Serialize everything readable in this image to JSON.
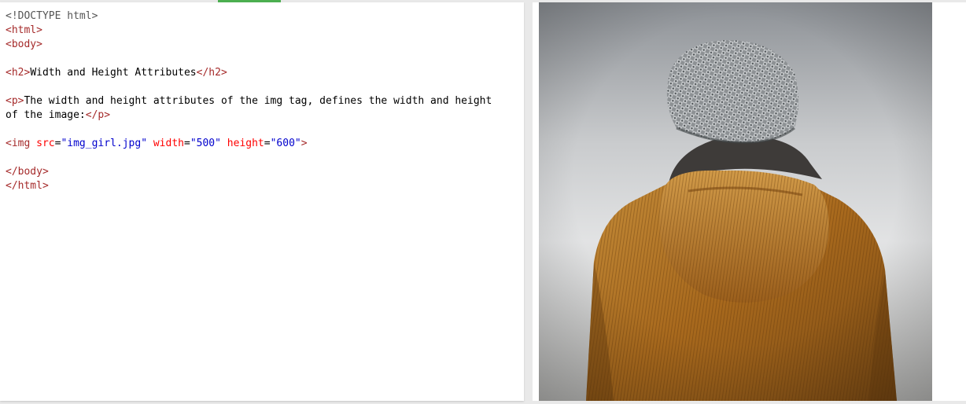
{
  "code": {
    "doctype": "<!DOCTYPE html>",
    "html_open_lt": "<",
    "html_open_name": "html",
    "html_open_gt": ">",
    "body_open_name": "body",
    "h2_name": "h2",
    "h2_text": "Width and Height Attributes",
    "h2_close_name": "/h2",
    "p_name": "p",
    "p_text_line1": "The width and height attributes of the img tag, defines the width and height",
    "p_text_line2": "of the image:",
    "p_close_name": "/p",
    "img_name": "img",
    "attr_src": "src",
    "val_src": "\"img_girl.jpg\"",
    "attr_width": "width",
    "val_width": "\"500\"",
    "attr_height": "height",
    "val_height": "\"600\"",
    "body_close_name": "/body",
    "html_close_name": "/html"
  },
  "result": {
    "image_subject": "person-in-knit-hat-and-corduroy-jacket"
  }
}
